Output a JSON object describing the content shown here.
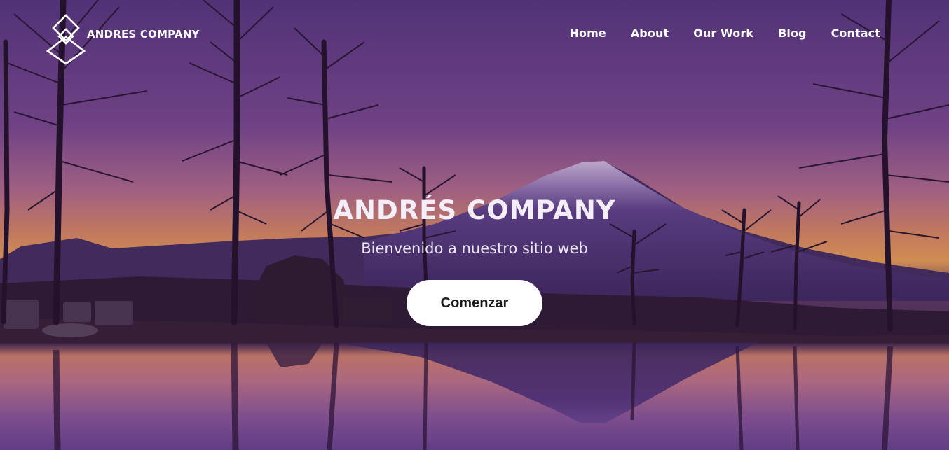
{
  "brand": {
    "name": "ANDRES COMPANY",
    "logo_icon": "diamond-logo-icon"
  },
  "nav": {
    "items": [
      {
        "label": "Home"
      },
      {
        "label": "About"
      },
      {
        "label": "Our Work"
      },
      {
        "label": "Blog"
      },
      {
        "label": "Contact"
      }
    ]
  },
  "hero": {
    "title": "ANDRÉS COMPANY",
    "subtitle": "Bienvenido a nuestro sitio web",
    "cta_label": "Comenzar",
    "background": "mount-fuji-sunset-lake-image"
  },
  "colors": {
    "sky_top": "#5a3a82",
    "sky_glow": "#f2a35a",
    "text": "#ffffff",
    "button_bg": "#ffffff",
    "button_text": "#1a1a1a"
  }
}
